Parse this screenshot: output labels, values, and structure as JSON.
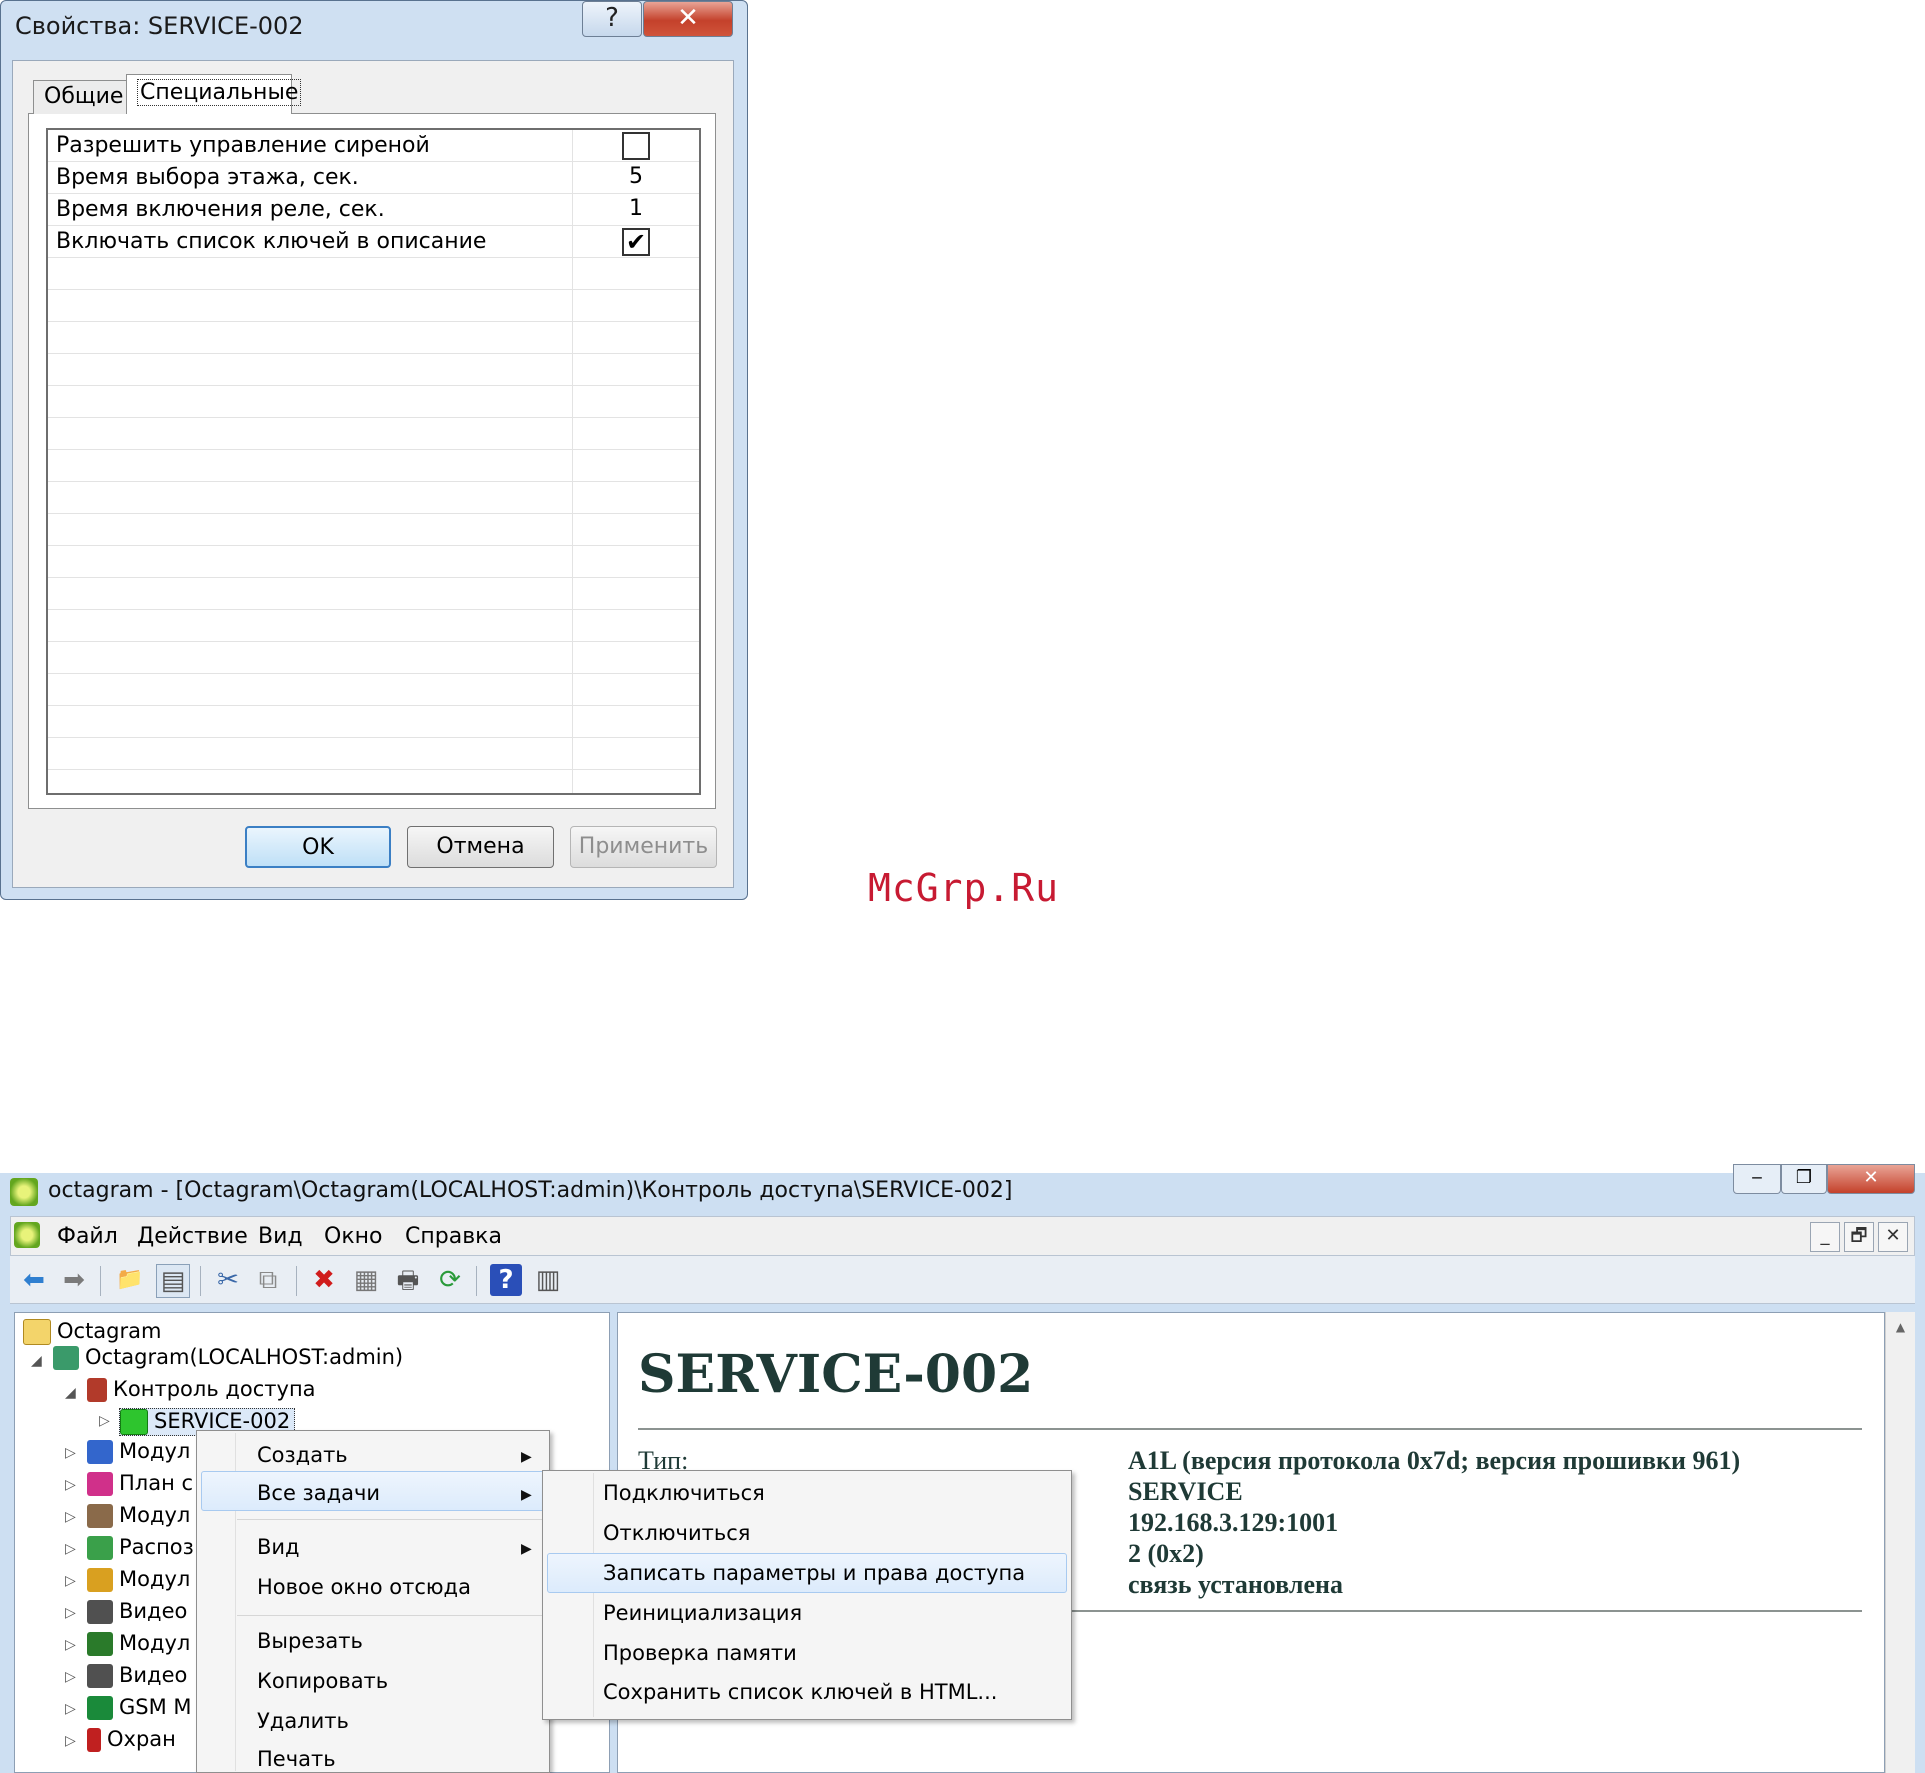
{
  "dialog": {
    "title": "Свойства: SERVICE-002",
    "help_glyph": "?",
    "close_glyph": "✕",
    "tabs": [
      "Общие",
      "Специальные"
    ],
    "active_tab": "Специальные",
    "properties": [
      {
        "label": "Разрешить управление сиреной",
        "type": "checkbox",
        "checked": false
      },
      {
        "label": "Время выбора этажа, сек.",
        "type": "value",
        "value": "5"
      },
      {
        "label": "Время включения реле, сек.",
        "type": "value",
        "value": "1"
      },
      {
        "label": "Включать список ключей в описание",
        "type": "checkbox",
        "checked": true
      }
    ],
    "check_glyph": "✔",
    "buttons": {
      "ok": "OK",
      "cancel": "Отмена",
      "apply": "Применить"
    }
  },
  "watermark": "McGrp.Ru",
  "mmc": {
    "title": "octagram - [Octagram\\Octagram(LOCALHOST:admin)\\Контроль доступа\\SERVICE-002]",
    "caption_glyphs": {
      "minimize": "‒",
      "restore": "❐",
      "close": "✕"
    },
    "mdi_glyphs": {
      "minimize": "_",
      "restore": "🗗",
      "close": "✕"
    },
    "menu": [
      "Файл",
      "Действие",
      "Вид",
      "Окно",
      "Справка"
    ],
    "toolbar_icons": [
      "back-icon",
      "forward-icon",
      "up-folder-icon",
      "show-hide-tree-icon",
      "cut-icon",
      "copy-icon",
      "delete-icon",
      "properties-icon",
      "print-icon",
      "refresh-icon",
      "help-icon",
      "show-action-pane-icon"
    ],
    "toolbar_glyphs": {
      "back": "⬅",
      "forward": "➡",
      "up": "📁",
      "tree": "▤",
      "cut": "✂",
      "copy": "⧉",
      "delete": "✖",
      "props": "▦",
      "print": "🖶",
      "refresh": "⟳",
      "help": "?",
      "pane": "▥"
    },
    "tree": [
      {
        "label": "Octagram",
        "icon": "folder-icon",
        "color": "#f3d46a"
      },
      {
        "label": "Octagram(LOCALHOST:admin)",
        "icon": "server-icon",
        "color": "#3a9a6a"
      },
      {
        "label": "Контроль доступа",
        "icon": "lock-icon",
        "color": "#b23a2a"
      },
      {
        "label": "SERVICE-002",
        "icon": "controller-icon",
        "color": "#2ec52e"
      },
      {
        "label": "Модул",
        "icon": "module-icon",
        "color": "#3366cc"
      },
      {
        "label": "План с",
        "icon": "plan-icon",
        "color": "#d0308a"
      },
      {
        "label": "Модул",
        "icon": "module2-icon",
        "color": "#8a6a4a"
      },
      {
        "label": "Распоз",
        "icon": "recognition-icon",
        "color": "#3aa04a"
      },
      {
        "label": "Модул",
        "icon": "module3-icon",
        "color": "#d9a020"
      },
      {
        "label": "Видео",
        "icon": "camera-icon",
        "color": "#505050"
      },
      {
        "label": "Модул",
        "icon": "module4-icon",
        "color": "#2a7a2a"
      },
      {
        "label": "Видео",
        "icon": "camera2-icon",
        "color": "#505050"
      },
      {
        "label": "GSM M",
        "icon": "gsm-icon",
        "color": "#1a8a3a"
      },
      {
        "label": "Охран",
        "icon": "security-icon",
        "color": "#c02020"
      }
    ],
    "details": {
      "heading": "SERVICE-002",
      "type_label": "Тип:",
      "values": [
        "A1L (версия протокола 0x7d; версия прошивки 961)",
        "SERVICE",
        "192.168.3.129:1001",
        "2 (0x2)",
        "связь установлена"
      ]
    },
    "context_menu": {
      "items": [
        "Создать",
        "Все задачи",
        "Вид",
        "Новое окно отсюда",
        "Вырезать",
        "Копировать",
        "Удалить",
        "Печать"
      ],
      "submenu_arrow": "▶",
      "highlighted": "Все задачи"
    },
    "submenu": {
      "items": [
        "Подключиться",
        "Отключиться",
        "Записать параметры и права доступа",
        "Реинициализация",
        "Проверка памяти",
        "Сохранить список ключей в HTML..."
      ],
      "highlighted": "Записать параметры и права доступа"
    },
    "scroll_up_glyph": "▲"
  }
}
